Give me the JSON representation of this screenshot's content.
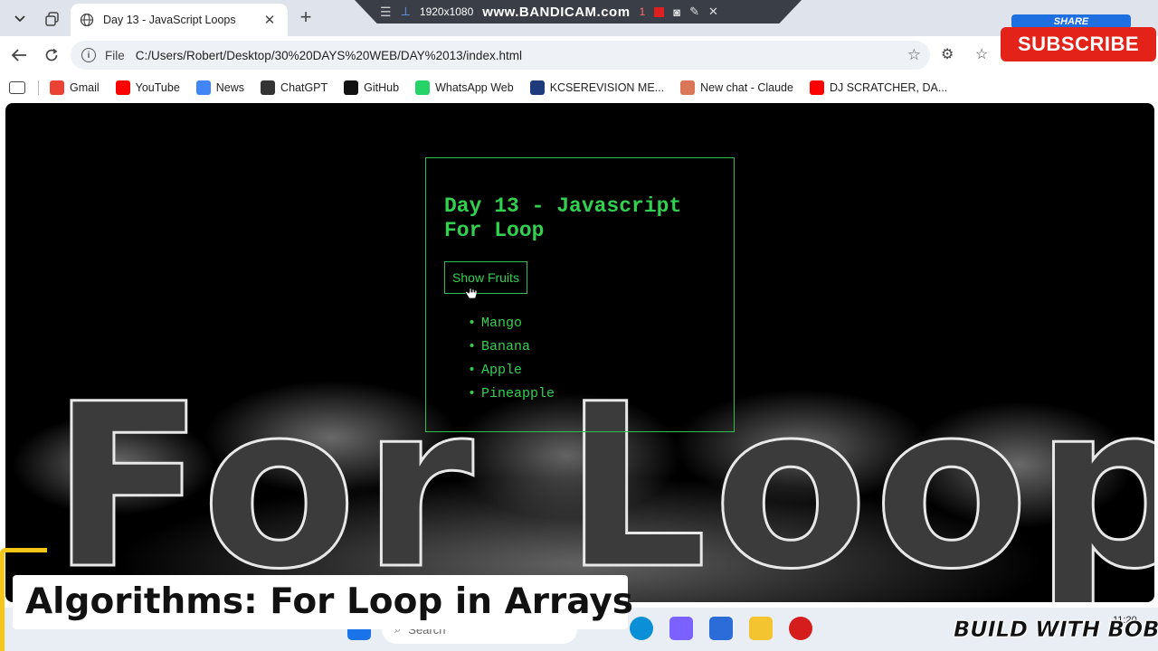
{
  "browser": {
    "tab_title": "Day 13 - JavaScript Loops",
    "address_scheme": "File",
    "url": "C:/Users/Robert/Desktop/30%20DAYS%20WEB/DAY%2013/index.html"
  },
  "bandicam": {
    "resolution": "1920x1080",
    "logo": "www.BANDICAM.com",
    "time": "1"
  },
  "bookmarks": [
    {
      "label": "Gmail",
      "icon": "gmail-icon",
      "color": "#ea4335"
    },
    {
      "label": "YouTube",
      "icon": "youtube-icon",
      "color": "#ff0000"
    },
    {
      "label": "News",
      "icon": "news-icon",
      "color": "#4285f4"
    },
    {
      "label": "ChatGPT",
      "icon": "chatgpt-icon",
      "color": "#333333"
    },
    {
      "label": "GitHub",
      "icon": "github-icon",
      "color": "#111111"
    },
    {
      "label": "WhatsApp Web",
      "icon": "whatsapp-icon",
      "color": "#25d366"
    },
    {
      "label": "KCSEREVISION ME...",
      "icon": "kcserevision-icon",
      "color": "#1d3b7a"
    },
    {
      "label": "New chat - Claude",
      "icon": "claude-icon",
      "color": "#d97757"
    },
    {
      "label": "DJ SCRATCHER, DA...",
      "icon": "youtube-icon",
      "color": "#ff0000"
    }
  ],
  "page": {
    "heading": "Day 13 - Javascript For Loop",
    "button_label": "Show Fruits",
    "fruits": [
      "Mango",
      "Banana",
      "Apple",
      "Pineapple"
    ],
    "accent": "#32d04f",
    "background_text": "For Loop"
  },
  "overlays": {
    "share": "SHARE",
    "subscribe": "SUBSCRIBE",
    "caption": "Algorithms: For Loop in Arrays",
    "channel": "BUILD WITH BOB"
  },
  "taskbar": {
    "search_placeholder": "Search",
    "time": "11:20"
  }
}
